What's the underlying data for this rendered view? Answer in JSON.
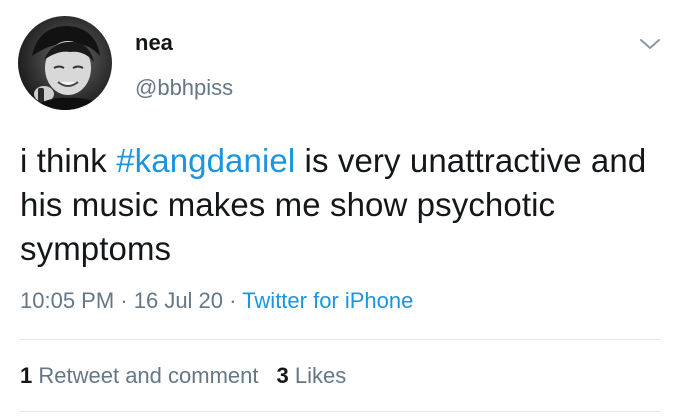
{
  "user": {
    "display_name": "nea",
    "handle": "@bbhpiss"
  },
  "tweet": {
    "text_before": "i think ",
    "hashtag": "#kangdaniel",
    "text_after": " is very unattractive and his music makes me show psychotic symptoms",
    "time": "10:05 PM",
    "date": "16 Jul 20",
    "separator": " · ",
    "source": "Twitter for iPhone"
  },
  "stats": {
    "retweets_count": "1",
    "retweets_label": "Retweet and comment",
    "likes_count": "3",
    "likes_label": "Likes"
  },
  "icons": {
    "caret": "chevron-down-icon",
    "avatar": "avatar"
  },
  "colors": {
    "link": "#1b95e0",
    "secondary": "#657786",
    "primary": "#14171a",
    "divider": "#e1e8ed"
  }
}
